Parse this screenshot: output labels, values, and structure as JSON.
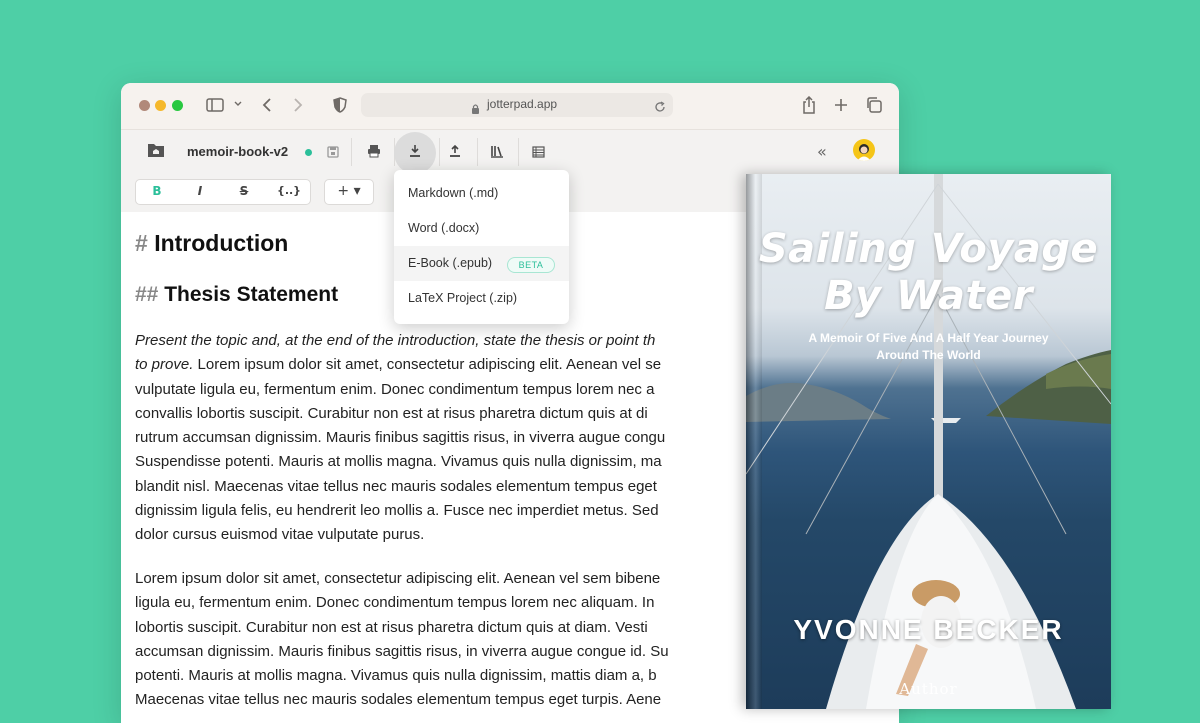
{
  "browser": {
    "url": "jotterpad.app"
  },
  "toolbar": {
    "document_name": "memoir-book-v2",
    "collapse_glyph": "«"
  },
  "format_bar": {
    "bold_label": "B",
    "italic_label": "I",
    "strike_label": "S",
    "code_label": "{..}",
    "insert_label": "+ ▾"
  },
  "editor": {
    "h1_hash": "#",
    "h1_text": "Introduction",
    "h2_hash": "##",
    "h2_text": "Thesis Statement",
    "paragraph1": {
      "italic_part": "Present the topic and, at the end of the introduction, state the thesis or point th",
      "italic_part2": "to prove.",
      "line1_rest": " Lorem ipsum dolor sit amet, consectetur adipiscing elit. Aenean vel se",
      "lines": [
        "vulputate ligula eu, fermentum enim. Donec condimentum tempus lorem nec a",
        "convallis lobortis suscipit. Curabitur non est at risus pharetra dictum quis at di",
        "rutrum accumsan dignissim. Mauris finibus sagittis risus, in viverra augue congu",
        "Suspendisse potenti. Mauris at mollis magna. Vivamus quis nulla dignissim, ma",
        "blandit nisl. Maecenas vitae tellus nec mauris sodales elementum tempus eget",
        "dignissim ligula felis, eu hendrerit leo mollis a. Fusce nec imperdiet metus. Sed",
        "dolor cursus euismod vitae vulputate purus."
      ]
    },
    "paragraph2": {
      "lines": [
        "Lorem ipsum dolor sit amet, consectetur adipiscing elit. Aenean vel sem bibene",
        "ligula eu, fermentum enim. Donec condimentum tempus lorem nec aliquam. In",
        "lobortis suscipit. Curabitur non est at risus pharetra dictum quis at diam. Vesti",
        "accumsan dignissim. Mauris finibus sagittis risus, in viverra augue congue id. Su",
        "potenti. Mauris at mollis magna. Vivamus quis nulla dignissim, mattis diam a, b",
        "Maecenas vitae tellus nec mauris sodales elementum tempus eget turpis. Aene"
      ]
    }
  },
  "export_menu": {
    "items": [
      {
        "label": "Markdown (.md)"
      },
      {
        "label": "Word (.docx)"
      },
      {
        "label": "E-Book (.epub)",
        "badge": "BETA"
      },
      {
        "label": "LaTeX Project (.zip)"
      }
    ]
  },
  "book_cover": {
    "title_line1": "Sailing Voyage",
    "title_line2": "By Water",
    "subtitle_line1": "A Memoir Of Five And A Half Year Journey",
    "subtitle_line2": "Around  The World",
    "author": "YVONNE  BECKER",
    "publisher": "Author"
  },
  "colors": {
    "background": "#4ecfa6",
    "accent": "#2bbf9a",
    "saved_dot": "#2bbf9a"
  }
}
